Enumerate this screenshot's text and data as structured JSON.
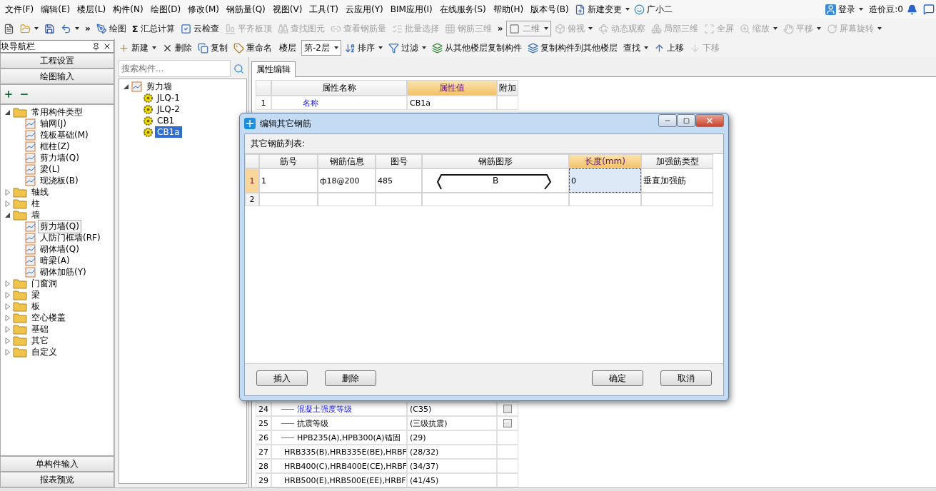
{
  "menu_bar": {
    "items": [
      "文件(F)",
      "编辑(E)",
      "楼层(L)",
      "构件(N)",
      "绘图(D)",
      "修改(M)",
      "钢筋量(Q)",
      "视图(V)",
      "工具(T)",
      "云应用(Y)",
      "BIM应用(I)",
      "在线服务(S)",
      "帮助(H)",
      "版本号(B)"
    ],
    "extras": [
      {
        "label": "新建变更",
        "dropdown": true
      },
      {
        "label": "广小二",
        "dropdown": false
      }
    ],
    "login": "登录",
    "beans": "造价豆:0"
  },
  "toolbar": [
    {
      "kind": "icon",
      "disabled": false,
      "dropdown": false
    },
    {
      "kind": "icon",
      "disabled": false,
      "dropdown": true
    },
    {
      "kind": "icon",
      "disabled": false,
      "dropdown": false
    },
    {
      "kind": "icon",
      "disabled": false,
      "dropdown": true
    },
    {
      "kind": "overflow",
      "label": "»",
      "disabled": false,
      "dropdown": false
    },
    {
      "kind": "button",
      "label": "绘图",
      "disabled": false,
      "dropdown": false
    },
    {
      "kind": "button",
      "label": "汇总计算",
      "symbol": "Σ",
      "disabled": false,
      "dropdown": false
    },
    {
      "kind": "button",
      "label": "云检查",
      "disabled": false,
      "dropdown": false
    },
    {
      "kind": "button",
      "label": "平齐板顶",
      "disabled": true,
      "dropdown": false
    },
    {
      "kind": "button",
      "label": "查找图元",
      "disabled": true,
      "dropdown": false
    },
    {
      "kind": "button",
      "label": "查看钢筋量",
      "disabled": true,
      "dropdown": false
    },
    {
      "kind": "button",
      "label": "批量选择",
      "disabled": true,
      "dropdown": false
    },
    {
      "kind": "button",
      "label": "钢筋三维",
      "disabled": true,
      "dropdown": false
    },
    {
      "kind": "overflow",
      "label": "»",
      "disabled": false,
      "dropdown": false
    },
    {
      "kind": "select",
      "label": "二维",
      "disabled": true,
      "dropdown": true
    },
    {
      "kind": "button",
      "label": "俯视",
      "disabled": true,
      "dropdown": true
    },
    {
      "kind": "button",
      "label": "动态观察",
      "disabled": true,
      "dropdown": false
    },
    {
      "kind": "button",
      "label": "局部三维",
      "disabled": true,
      "dropdown": false
    },
    {
      "kind": "button",
      "label": "全屏",
      "disabled": true,
      "dropdown": false
    },
    {
      "kind": "button",
      "label": "缩放",
      "disabled": true,
      "dropdown": true
    },
    {
      "kind": "button",
      "label": "平移",
      "disabled": true,
      "dropdown": true
    },
    {
      "kind": "button",
      "label": "屏幕旋转",
      "disabled": true,
      "dropdown": true
    }
  ],
  "nav_panel": {
    "title": "块导航栏",
    "buttons": [
      "工程设置",
      "绘图输入"
    ],
    "tree": [
      {
        "label": "常用构件类型",
        "expanded": true,
        "children": [
          {
            "label": "轴网(J)",
            "selected": false
          },
          {
            "label": "筏板基础(M)",
            "selected": false
          },
          {
            "label": "框柱(Z)",
            "selected": false
          },
          {
            "label": "剪力墙(Q)",
            "selected": false
          },
          {
            "label": "梁(L)",
            "selected": false
          },
          {
            "label": "现浇板(B)",
            "selected": false
          }
        ]
      },
      {
        "label": "轴线",
        "expanded": false
      },
      {
        "label": "柱",
        "expanded": false
      },
      {
        "label": "墙",
        "expanded": true,
        "children": [
          {
            "label": "剪力墙(Q)",
            "selected": true
          },
          {
            "label": "人防门框墙(RF)",
            "selected": false
          },
          {
            "label": "砌体墙(Q)",
            "selected": false
          },
          {
            "label": "暗梁(A)",
            "selected": false
          },
          {
            "label": "砌体加筋(Y)",
            "selected": false
          }
        ]
      },
      {
        "label": "门窗洞",
        "expanded": false
      },
      {
        "label": "梁",
        "expanded": false
      },
      {
        "label": "板",
        "expanded": false
      },
      {
        "label": "空心楼盖",
        "expanded": false
      },
      {
        "label": "基础",
        "expanded": false
      },
      {
        "label": "其它",
        "expanded": false
      },
      {
        "label": "自定义",
        "expanded": false
      }
    ],
    "bottom_buttons": [
      "单构件输入",
      "报表预览"
    ]
  },
  "component_toolbar": [
    {
      "kind": "button",
      "label": "新建",
      "disabled": false,
      "dropdown": true
    },
    {
      "kind": "button",
      "label": "删除",
      "disabled": false,
      "dropdown": false
    },
    {
      "kind": "button",
      "label": "复制",
      "disabled": false,
      "dropdown": false
    },
    {
      "kind": "button",
      "label": "重命名",
      "disabled": false,
      "dropdown": false
    },
    {
      "kind": "label",
      "label": "楼层"
    },
    {
      "kind": "select",
      "label": "第-2层",
      "disabled": false,
      "dropdown": true
    },
    {
      "kind": "button",
      "label": "排序",
      "disabled": false,
      "dropdown": true
    },
    {
      "kind": "button",
      "label": "过滤",
      "disabled": false,
      "dropdown": true
    },
    {
      "kind": "button",
      "label": "从其他楼层复制构件",
      "disabled": false,
      "dropdown": false
    },
    {
      "kind": "button",
      "label": "复制构件到其他楼层",
      "disabled": false,
      "dropdown": false
    },
    {
      "kind": "button",
      "label": "查找",
      "disabled": false,
      "dropdown": true
    },
    {
      "kind": "button",
      "label": "上移",
      "disabled": false,
      "dropdown": false
    },
    {
      "kind": "button",
      "label": "下移",
      "disabled": true,
      "dropdown": false
    }
  ],
  "component_list": {
    "search_placeholder": "搜索构件...",
    "tree": [
      {
        "label": "剪力墙",
        "expanded": true,
        "selected": false,
        "children": [
          {
            "label": "JLQ-1",
            "selected": false
          },
          {
            "label": "JLQ-2",
            "selected": false
          },
          {
            "label": "CB1",
            "selected": false
          },
          {
            "label": "CB1a",
            "selected": true
          }
        ]
      }
    ]
  },
  "properties": {
    "tab": "属性编辑",
    "columns": [
      {
        "label": "属性名称",
        "selected": false
      },
      {
        "label": "属性值",
        "selected": true
      },
      {
        "label": "附加",
        "selected": false
      }
    ],
    "top_rows": [
      {
        "num": "1",
        "name": "名称",
        "value": "CB1a",
        "link": true
      }
    ],
    "bottom_rows": [
      {
        "num": "24",
        "name": "混凝土强度等级",
        "value": "(C35)",
        "link": true,
        "checked": false
      },
      {
        "num": "25",
        "name": "抗震等级",
        "value": "(三级抗震)",
        "link": false,
        "checked": false
      },
      {
        "num": "26",
        "name": "HPB235(A),HPB300(A)锚固",
        "value": "(29)",
        "link": false
      },
      {
        "num": "27",
        "name": "HRB335(B),HRB335E(BE),HRBF",
        "value": "(28/32)",
        "link": false
      },
      {
        "num": "28",
        "name": "HRB400(C),HRB400E(CE),HRBF",
        "value": "(34/37)",
        "link": false
      },
      {
        "num": "29",
        "name": "HRB500(E),HRB500E(EE),HRBF",
        "value": "(41/45)",
        "link": false
      }
    ]
  },
  "dialog": {
    "title": "编辑其它钢筋",
    "list_label": "其它钢筋列表:",
    "columns": [
      {
        "label": "筋号",
        "selected": false
      },
      {
        "label": "钢筋信息",
        "selected": false
      },
      {
        "label": "图号",
        "selected": false
      },
      {
        "label": "钢筋图形",
        "selected": false
      },
      {
        "label": "长度(mm)",
        "selected": true
      },
      {
        "label": "加强筋类型",
        "selected": false
      }
    ],
    "rows": [
      {
        "num": "1",
        "selected": true,
        "cells": [
          "1",
          "ф18@200",
          "485",
          "B",
          "0",
          "垂直加强筋"
        ]
      },
      {
        "num": "2",
        "selected": false
      }
    ],
    "left_buttons": [
      "插入",
      "删除"
    ],
    "right_buttons": [
      "确定",
      "取消"
    ]
  }
}
